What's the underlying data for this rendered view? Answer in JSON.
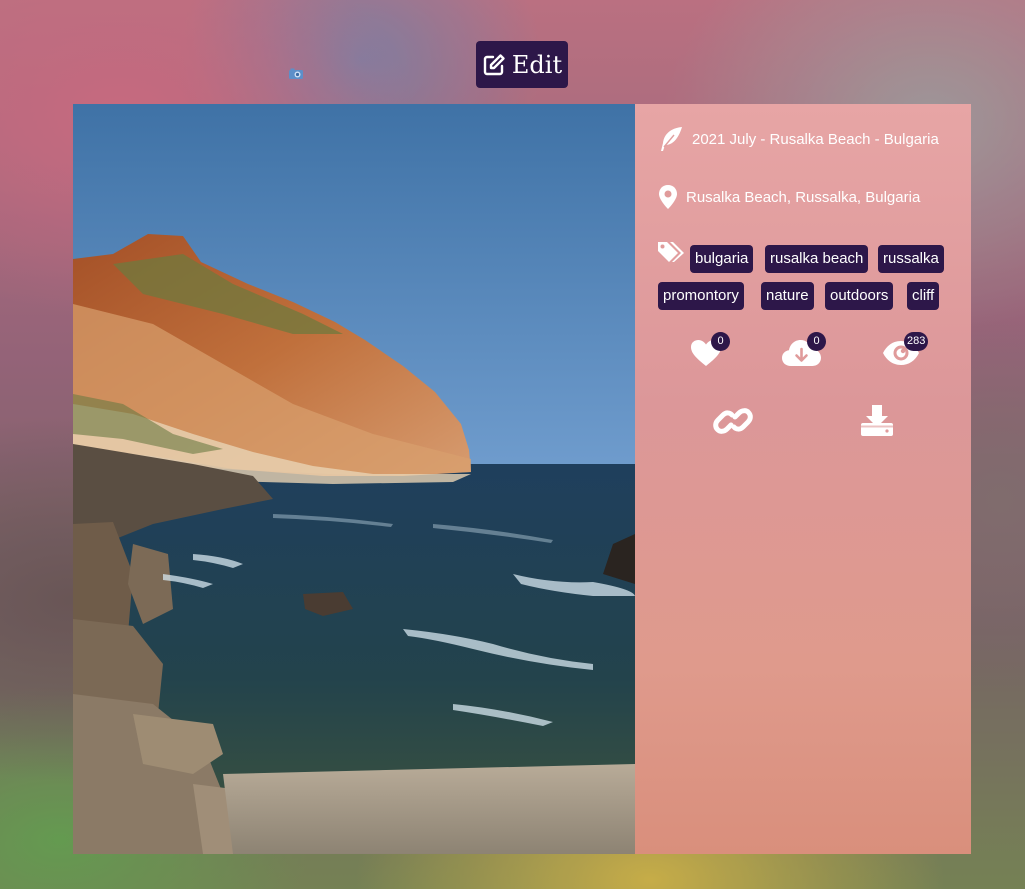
{
  "toolbar": {
    "edit_label": "Edit"
  },
  "photo": {
    "title": "2021 July - Rusalka Beach - Bulgaria",
    "location": "Rusalka Beach, Russalka, Bulgaria",
    "tags": [
      "bulgaria",
      "rusalka beach",
      "russalka",
      "promontory",
      "nature",
      "outdoors",
      "cliff"
    ]
  },
  "stats": {
    "likes": "0",
    "downloads": "0",
    "views": "283"
  },
  "icons": {
    "title": "feather-icon",
    "location": "map-pin-icon",
    "tags": "tags-icon",
    "likes": "heart-icon",
    "downloads": "cloud-download-icon",
    "views": "eye-icon",
    "link": "link-icon",
    "download": "download-icon",
    "edit": "edit-icon",
    "camera": "camera-icon"
  },
  "colors": {
    "accent": "#2d1749",
    "text": "#ffffff",
    "panel": "#e09b9b"
  }
}
